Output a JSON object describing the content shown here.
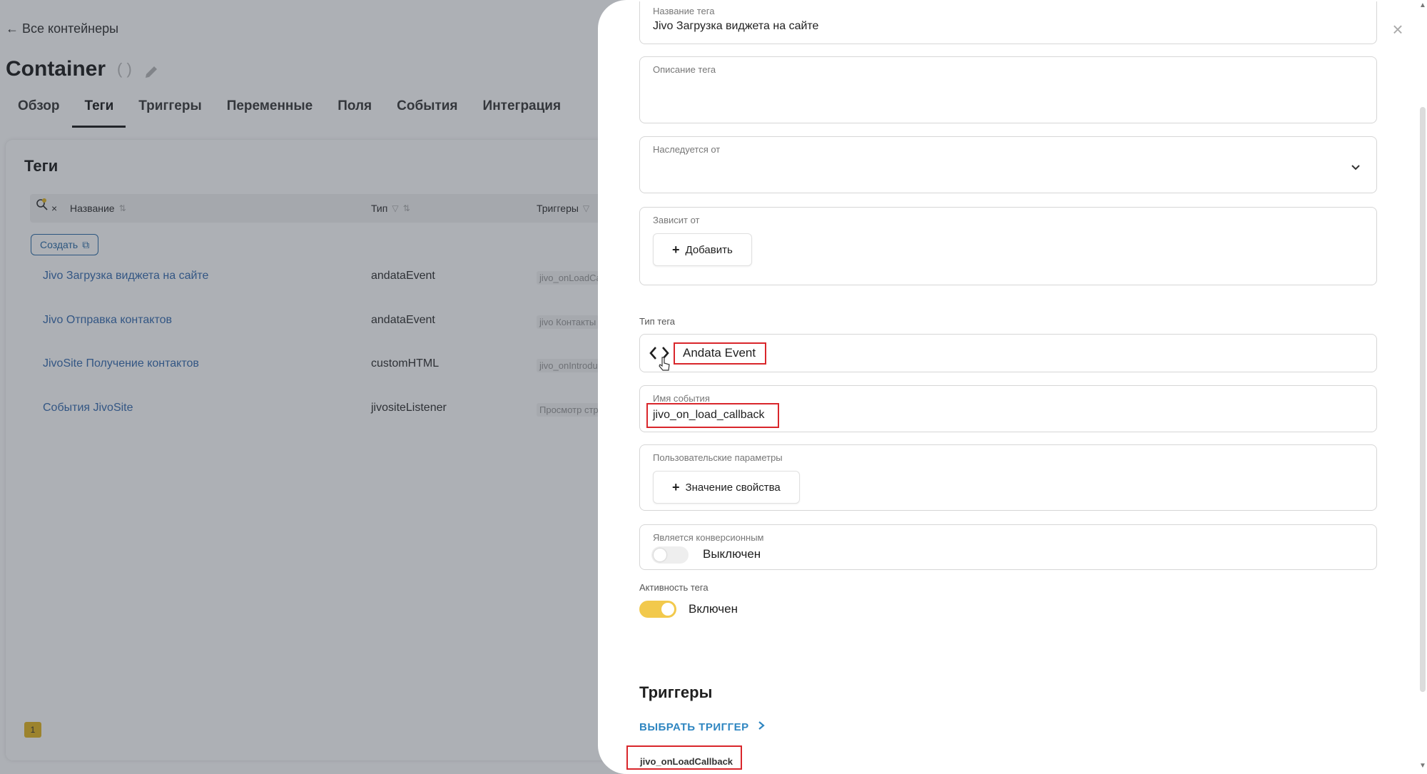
{
  "background": {
    "back_link": "← Все контейнеры",
    "title": "Container",
    "title_paren": "( )",
    "tabs": [
      "Обзор",
      "Теги",
      "Триггеры",
      "Переменные",
      "Поля",
      "События",
      "Интеграция"
    ],
    "active_tab": "Теги",
    "card_title": "Теги",
    "table": {
      "headers": {
        "name": "Название",
        "type": "Тип",
        "triggers": "Триггеры"
      },
      "create_label": "Создать",
      "rows": [
        {
          "name": "Jivo Загрузка виджета на сайте",
          "type": "andataEvent",
          "trigger": "jivo_onLoadCa"
        },
        {
          "name": "Jivo Отправка контактов",
          "type": "andataEvent",
          "trigger": "jivo Контакты"
        },
        {
          "name": "JivoSite Получение контактов",
          "type": "customHTML",
          "trigger": "jivo_onIntrodu"
        },
        {
          "name": "События JivoSite",
          "type": "jivositeListener",
          "trigger": "Просмотр стр"
        }
      ]
    },
    "page_number": "1"
  },
  "panel": {
    "tag_name_label": "Название тега",
    "tag_name_value": "Jivo Загрузка виджета на сайте",
    "description_label": "Описание тега",
    "inherits_label": "Наследуется от",
    "depends_label": "Зависит от",
    "add_label": "Добавить",
    "tag_type_label": "Тип тега",
    "tag_type_value": "Andata Event",
    "event_name_label": "Имя события",
    "event_name_value": "jivo_on_load_callback",
    "custom_params_label": "Пользовательские параметры",
    "property_value_label": "Значение свойства",
    "conversion_label": "Является конверсионным",
    "conversion_state": "Выключен",
    "activity_label": "Активность тега",
    "activity_state": "Включен",
    "triggers_title": "Триггеры",
    "choose_trigger": "ВЫБРАТЬ ТРИГГЕР",
    "selected_trigger": "jivo_onLoadCallback"
  },
  "colors": {
    "accent_yellow": "#f2c94c",
    "link_blue": "#3b6fb0",
    "highlight_red": "#d9262b"
  }
}
